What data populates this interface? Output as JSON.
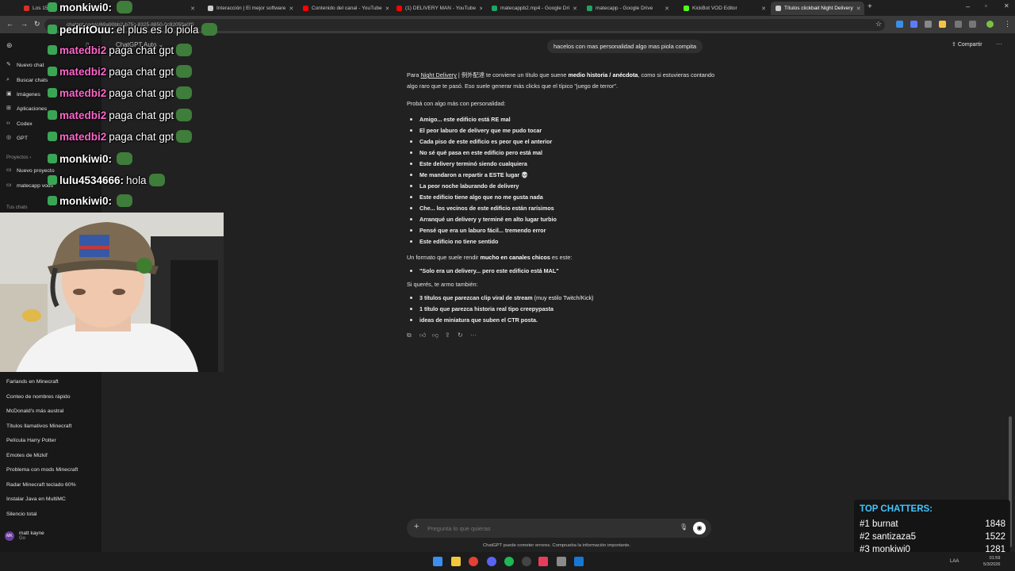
{
  "browser": {
    "tabs": [
      {
        "label": "Los 15 F...",
        "color": "#d93025"
      },
      {
        "label": "Interacción | El mejor software",
        "color": "#cccccc"
      },
      {
        "label": "Contenido del canal - YouTube",
        "color": "#ff0000"
      },
      {
        "label": "(1) DELIVERY MAN - YouTube",
        "color": "#ff0000"
      },
      {
        "label": "matecappb2.mp4 - Google Dri",
        "color": "#1fa463"
      },
      {
        "label": "matecapp - Google Drive",
        "color": "#1fa463"
      },
      {
        "label": "KickBot VOD Editor",
        "color": "#53fc18"
      },
      {
        "label": "Títulos clickbait Night Delivery",
        "color": "#cccccc"
      }
    ],
    "new_tab": "+",
    "url": "chatgpt.com/c/69a90bb2-b75c-8325-8850-0c92059a0f0"
  },
  "sidebar": {
    "items": [
      {
        "icon": "✎",
        "label": "Nuevo chat"
      },
      {
        "icon": "⌕",
        "label": "Buscar chats"
      },
      {
        "icon": "▣",
        "label": "Imágenes"
      },
      {
        "icon": "⊞",
        "label": "Aplicaciones"
      },
      {
        "icon": "‹›",
        "label": "Codex"
      },
      {
        "icon": "◎",
        "label": "GPT"
      }
    ],
    "projects_heading": "Proyectos ›",
    "projects": [
      {
        "icon": "▭",
        "label": "Nuevo proyecto"
      },
      {
        "icon": "▭",
        "label": "matecapp vods"
      }
    ],
    "chats_heading": "Tus chats",
    "chats": [
      "Farlands en Minecraft",
      "Conteo de nombres rápido",
      "McDonald's más austral",
      "Títulos llamativos Minecraft",
      "Película Harry Potter",
      "Emotes de Mizkif",
      "Problema con mods Minecraft",
      "Radar Minecraft teclado 60%",
      "Instalar Java en MultiMC",
      "Silencio total"
    ],
    "user": {
      "initials": "MK",
      "name": "matt kayne",
      "plan": "Go"
    }
  },
  "header": {
    "model": "ChatGPT Auto ⌄",
    "share": "Compartir",
    "more": "···"
  },
  "conversation": {
    "user_message": "hacelos con mas personalidad algo mas piola compita",
    "intro": {
      "a": "Para ",
      "channel": "Night Delivery",
      "b": " | 例外配達 te conviene un título que suene ",
      "bold": "medio historia / anécdota",
      "c": ", como si estuvieras contando algo raro que te pasó. Eso suele generar más clicks que el típico \"juego de terror\"."
    },
    "lead": "Probá con algo más con personalidad:",
    "titles": [
      "Amigo... este edificio está RE mal",
      "El peor laburo de delivery que me pudo tocar",
      "Cada piso de este edificio es peor que el anterior",
      "No sé qué pasa en este edificio pero está mal",
      "Este delivery terminó siendo cualquiera",
      "Me mandaron a repartir a ESTE lugar 💀",
      "La peor noche laburando de delivery",
      "Este edificio tiene algo que no me gusta nada",
      "Che... los vecinos de este edificio están rarísimos",
      "Arranqué un delivery y terminé en alto lugar turbio",
      "Pensé que era un laburo fácil... tremendo error",
      "Este edificio no tiene sentido"
    ],
    "format_a": "Un formato que suele rendir ",
    "format_bold": "mucho en canales chicos",
    "format_b": " es este:",
    "format_example": "\"Solo era un delivery... pero este edificio está MAL\"",
    "offer": "Si querés, te armo también:",
    "offers": [
      {
        "bold": "3 títulos que parezcan clip viral de stream",
        "normal": " (muy estilo Twitch/Kick)"
      },
      {
        "bold": "1 título que parezca historia real tipo creepypasta",
        "normal": ""
      },
      {
        "bold": "ideas de miniatura que suben el CTR posta.",
        "normal": ""
      }
    ]
  },
  "composer": {
    "placeholder": "Pregunta lo que quieras",
    "plus": "+",
    "mic": "🎙",
    "voice": "◉"
  },
  "disclaimer": "ChatGPT puede cometer errores. Comprueba la información importante.",
  "stream_chat": [
    {
      "user": "monkiwi0:",
      "msg": "",
      "color": "#ffffff"
    },
    {
      "user": "pedritOuu:",
      "msg": "el plus es lo piola",
      "color": "#ffffff"
    },
    {
      "user": "matedbi2",
      "msg": "paga chat gpt",
      "color": "#ff66cc"
    },
    {
      "user": "matedbi2",
      "msg": "paga chat gpt",
      "color": "#ff66cc"
    },
    {
      "user": "matedbi2",
      "msg": "paga chat gpt",
      "color": "#ff66cc"
    },
    {
      "user": "matedbi2",
      "msg": "paga chat gpt",
      "color": "#ff66cc"
    },
    {
      "user": "matedbi2",
      "msg": "paga chat gpt",
      "color": "#ff66cc"
    },
    {
      "user": "monkiwi0:",
      "msg": "",
      "color": "#ffffff"
    },
    {
      "user": "lulu4534666:",
      "msg": "hola",
      "color": "#ffffff"
    },
    {
      "user": "monkiwi0:",
      "msg": "",
      "color": "#ffffff"
    }
  ],
  "top_chatters": {
    "title": "TOP CHATTERS:",
    "rows": [
      {
        "rank": "#1",
        "name": "burnat",
        "count": "1848"
      },
      {
        "rank": "#2",
        "name": "santizaza5",
        "count": "1522"
      },
      {
        "rank": "#3",
        "name": "monkiwi0",
        "count": "1281"
      }
    ]
  },
  "taskbar": {
    "lang": "LAA",
    "time": "01:59",
    "date": "5/3/2026"
  }
}
